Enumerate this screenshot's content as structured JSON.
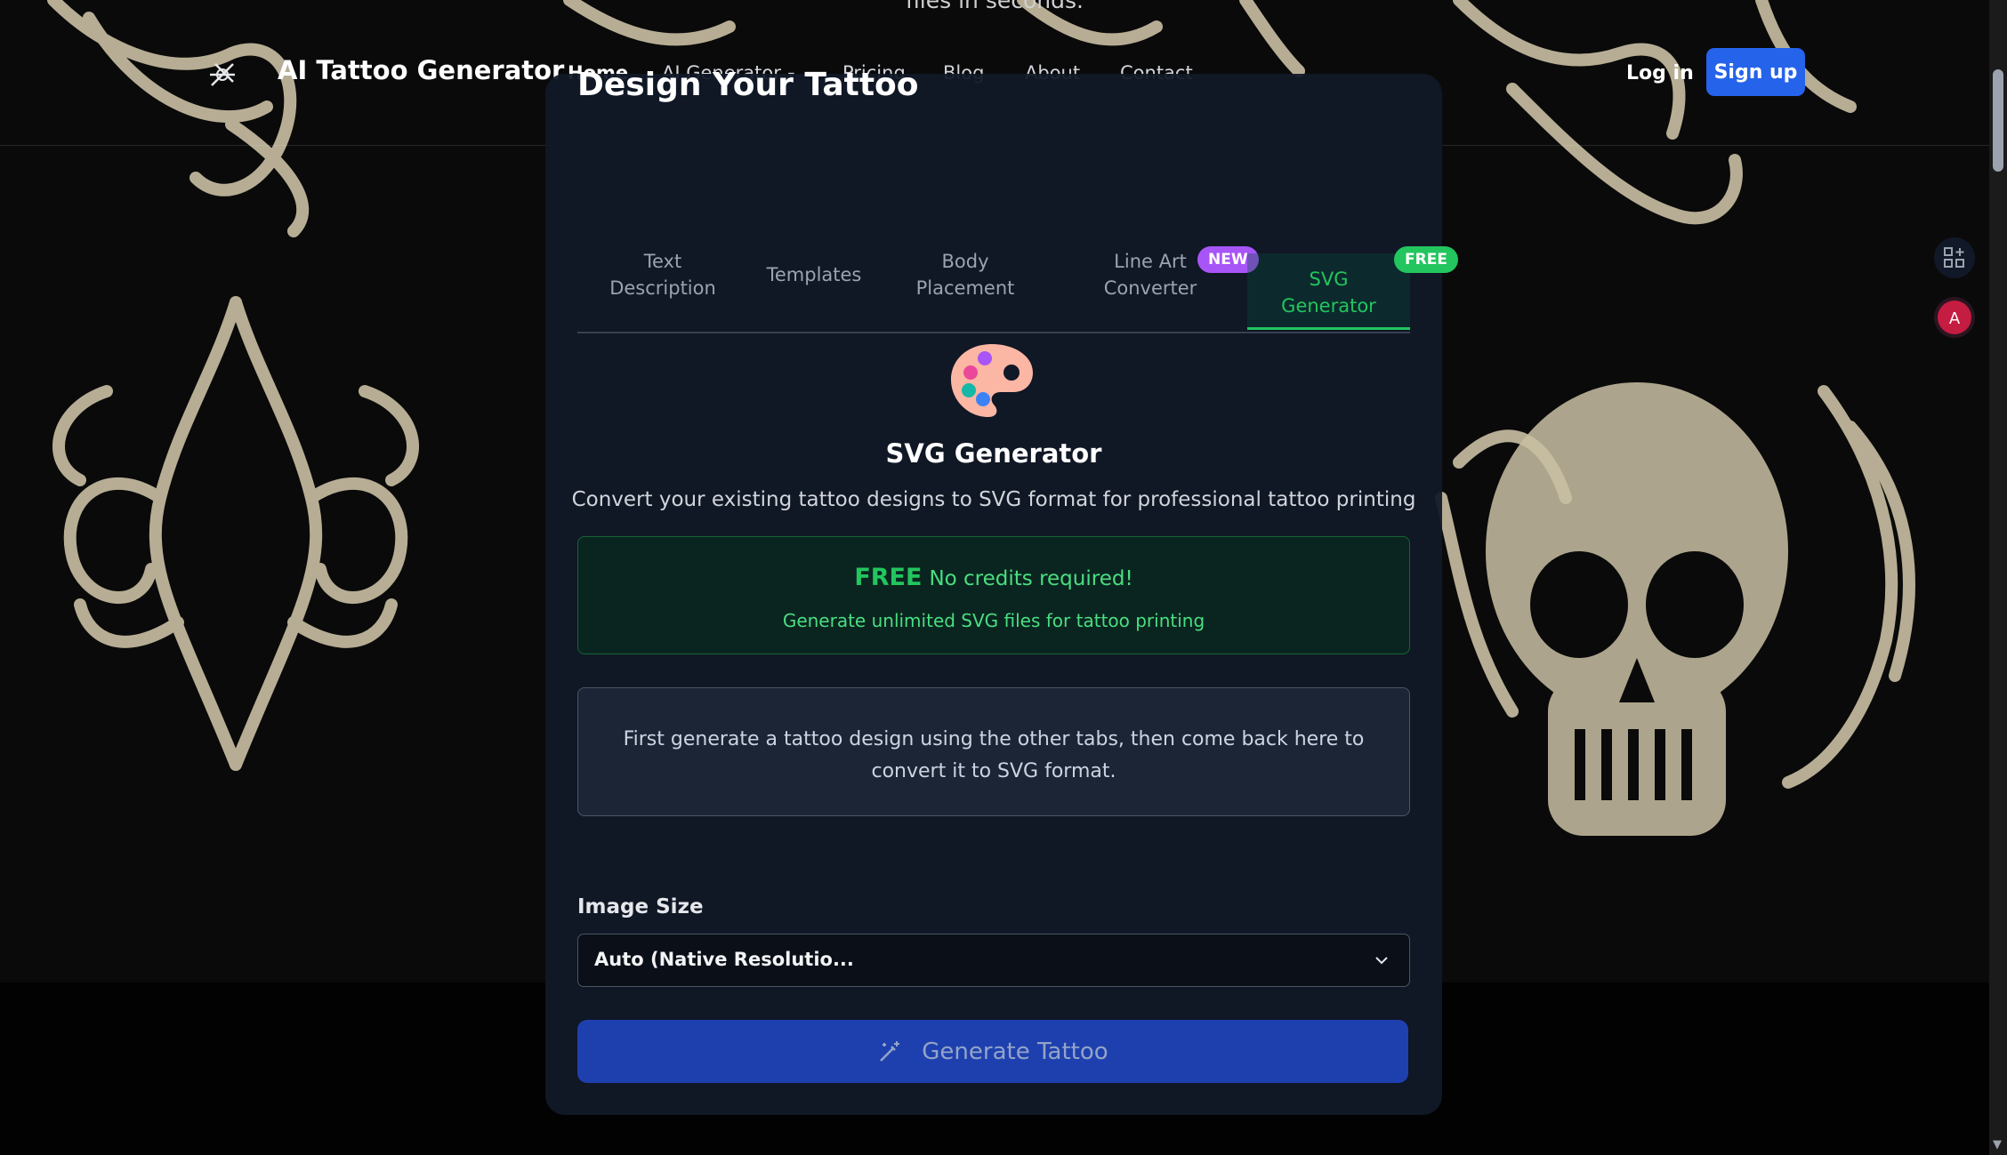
{
  "hero": {
    "tail_text": "files in seconds."
  },
  "nav": {
    "brand": "AI Tattoo Generator",
    "links": [
      "Home",
      "AI Generator",
      "Pricing",
      "Blog",
      "About",
      "Contact"
    ],
    "login": "Log in",
    "signup": "Sign up"
  },
  "card": {
    "title": "Design Your Tattoo",
    "tabs": [
      {
        "line1": "Text",
        "line2": "Description"
      },
      {
        "line1": "Templates",
        "line2": ""
      },
      {
        "line1": "Body",
        "line2": "Placement"
      },
      {
        "line1": "Line Art",
        "line2": "Converter",
        "badge": "NEW"
      },
      {
        "line1": "SVG",
        "line2": "Generator",
        "badge": "FREE"
      }
    ],
    "active_tab": "SVG Generator",
    "section_title": "SVG Generator",
    "section_subtitle": "Convert your existing tattoo designs to SVG format for professional tattoo printing",
    "free_box": {
      "free_word": "FREE",
      "note": "No credits required!",
      "subtext": "Generate unlimited SVG files for tattoo printing"
    },
    "info_text": "First generate a tattoo design using the other tabs, then come back here to convert it to SVG format.",
    "image_size_label": "Image Size",
    "image_size_value": "Auto (Native Resolutio...",
    "generate_button": "Generate Tattoo"
  },
  "colors": {
    "accent_blue": "#2563eb",
    "button_blue": "#1e40af",
    "free_green": "#22c55e",
    "new_purple": "#a855f7",
    "art_beige": "#c9bfa3"
  },
  "icons": [
    "logo-icon",
    "chevron-down-icon",
    "palette-icon",
    "magic-wand-icon",
    "apps-icon",
    "translate-icon"
  ]
}
